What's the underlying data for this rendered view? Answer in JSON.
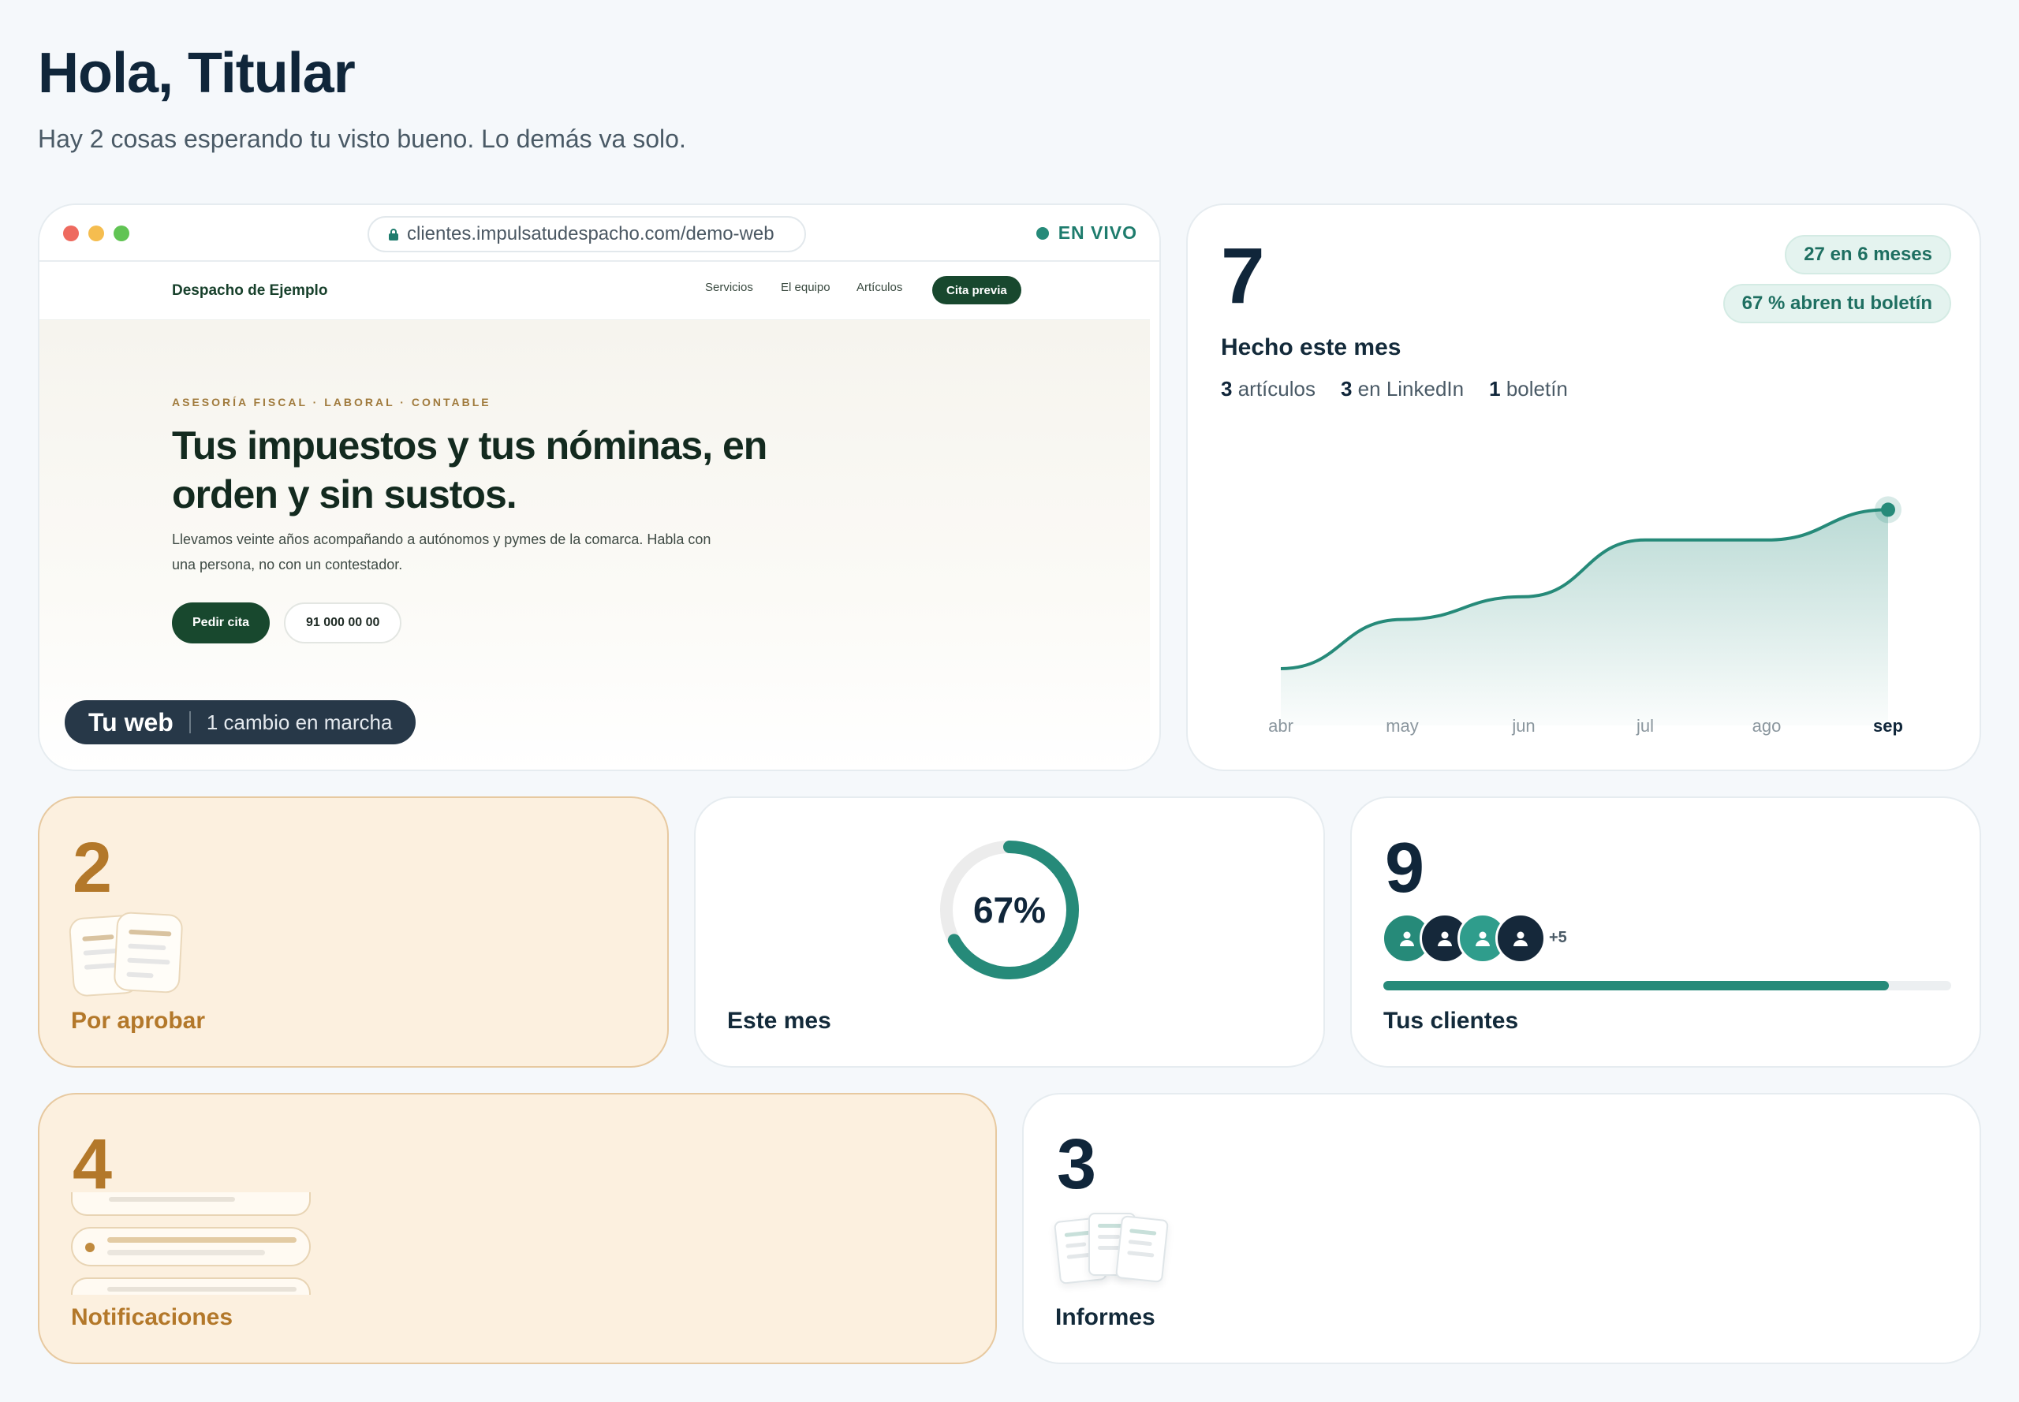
{
  "header": {
    "greeting": "Hola, Titular",
    "subtitle": "Hay 2 cosas esperando tu visto bueno. Lo demás va solo."
  },
  "browser": {
    "url": "clientes.impulsatudespacho.com/demo-web",
    "live_label": "EN VIVO",
    "site": {
      "logo": "Despacho de Ejemplo",
      "nav": [
        "Servicios",
        "El equipo",
        "Artículos"
      ],
      "cta": "Cita previa",
      "eyebrow": "ASESORÍA FISCAL · LABORAL · CONTABLE",
      "title": "Tus impuestos y tus nóminas, en orden y sin sustos.",
      "text": "Llevamos veinte años acompañando a autónomos y pymes de la comarca. Habla con una persona, no con un contestador.",
      "primary_button": "Pedir cita",
      "secondary_button": "91 000 00 00"
    },
    "pill": {
      "title": "Tu web",
      "status": "1 cambio en marcha"
    }
  },
  "stats": {
    "number": "7",
    "label": "Hecho este mes",
    "items": [
      {
        "count": "3",
        "text": "artículos"
      },
      {
        "count": "3",
        "text": "en LinkedIn"
      },
      {
        "count": "1",
        "text": "boletín"
      }
    ],
    "badges": [
      "27 en 6 meses",
      "67 % abren tu boletín"
    ],
    "accent_color": "#268a79"
  },
  "chart_data": {
    "type": "area",
    "categories": [
      "abr",
      "may",
      "jun",
      "jul",
      "ago",
      "sep"
    ],
    "values": [
      1.0,
      2.3,
      2.9,
      4.4,
      4.4,
      5.2
    ],
    "highlight": "sep",
    "ylim": [
      0,
      8
    ],
    "grid": false
  },
  "pending": {
    "number": "2",
    "label": "Por aprobar",
    "icon": "documents-icon"
  },
  "month": {
    "percent": 67,
    "percent_label": "67%",
    "label": "Este mes"
  },
  "clients": {
    "number": "9",
    "more": "+5",
    "progress": 0.89,
    "label": "Tus clientes",
    "avatar_colors": [
      "#268a79",
      "#15283a",
      "#2f9d8c",
      "#15283a"
    ]
  },
  "notifications": {
    "number": "4",
    "label": "Notificaciones",
    "icon": "notification-list-icon"
  },
  "reports": {
    "number": "3",
    "label": "Informes",
    "icon": "reports-icon"
  }
}
